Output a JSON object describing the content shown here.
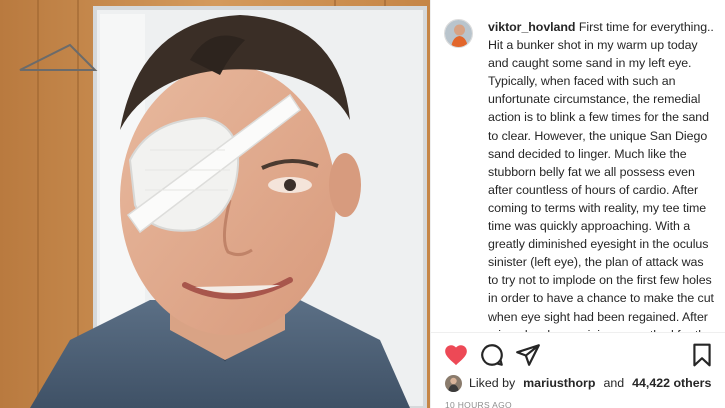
{
  "post": {
    "username": "viktor_hovland",
    "caption": "First time for everything.. Hit a bunker shot in my warm up today and caught some sand in my left eye. Typically, when faced with such an unfortunate circumstance, the remedial action is to blink a few times for the sand to clear. However, the unique San Diego sand decided to linger. Much like the stubborn belly fat we all possess even after countless of hours of cardio. After coming to terms with reality, my tee time time was quickly approaching. With a greatly diminished eyesight in the oculus sinister (left eye), the plan of attack was to try not to implode on the first few holes in order to have a chance to make the cut when eye sight had been regained. After miraculously remaining unscathed for the first four holes, I",
    "liked": true,
    "likes_prefix": "Liked by",
    "liked_by_user": "mariusthorp",
    "likes_conjunction": "and",
    "likes_others": "44,422 others",
    "timestamp": "10 HOURS AGO"
  },
  "icons": {
    "like": "heart-icon",
    "comment": "comment-icon",
    "share": "share-icon",
    "save": "bookmark-icon"
  },
  "colors": {
    "like_red": "#ed4956",
    "text": "#262626",
    "muted": "#8e8e8e"
  }
}
